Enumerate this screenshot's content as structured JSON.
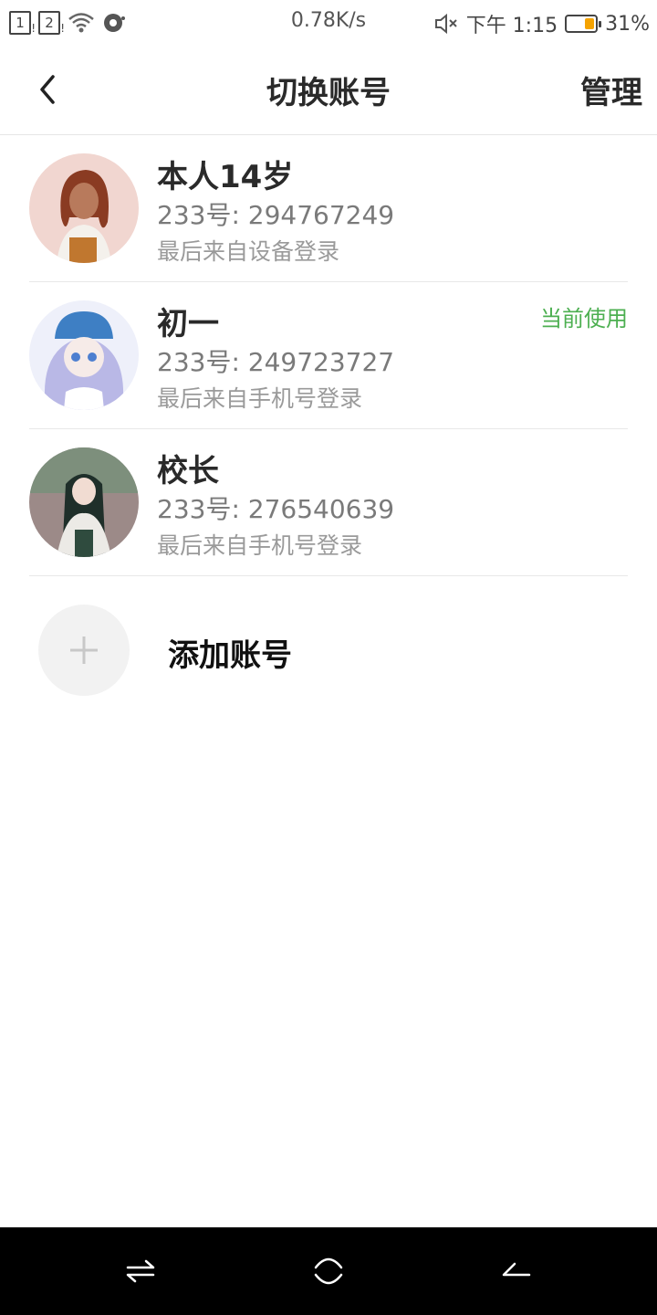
{
  "status_bar": {
    "sim1": "1",
    "sim2": "2",
    "network_speed": "0.78K/s",
    "time": "下午 1:15",
    "battery_percent": "31%",
    "battery_level": 0.31,
    "icons": [
      "wifi-icon",
      "sync-icon",
      "mute-icon",
      "battery-icon"
    ]
  },
  "header": {
    "title": "切换账号",
    "manage_label": "管理",
    "back_icon": "chevron-left-icon"
  },
  "accounts": [
    {
      "name": "本人14岁",
      "id_text": "233号: 294767249",
      "login_text": "最后来自设备登录",
      "current": false
    },
    {
      "name": "初一",
      "id_text": "233号: 249723727",
      "login_text": "最后来自手机号登录",
      "current": true,
      "current_label": "当前使用"
    },
    {
      "name": "校长",
      "id_text": "233号: 276540639",
      "login_text": "最后来自手机号登录",
      "current": false
    }
  ],
  "add_account": {
    "label": "添加账号",
    "icon": "plus-icon"
  },
  "colors": {
    "accent_green": "#4caf50",
    "battery_fill": "#f5a300",
    "nav_bar": "#000000"
  },
  "nav_bar": {
    "icons": [
      "recent-apps-icon",
      "home-icon",
      "back-icon"
    ]
  }
}
